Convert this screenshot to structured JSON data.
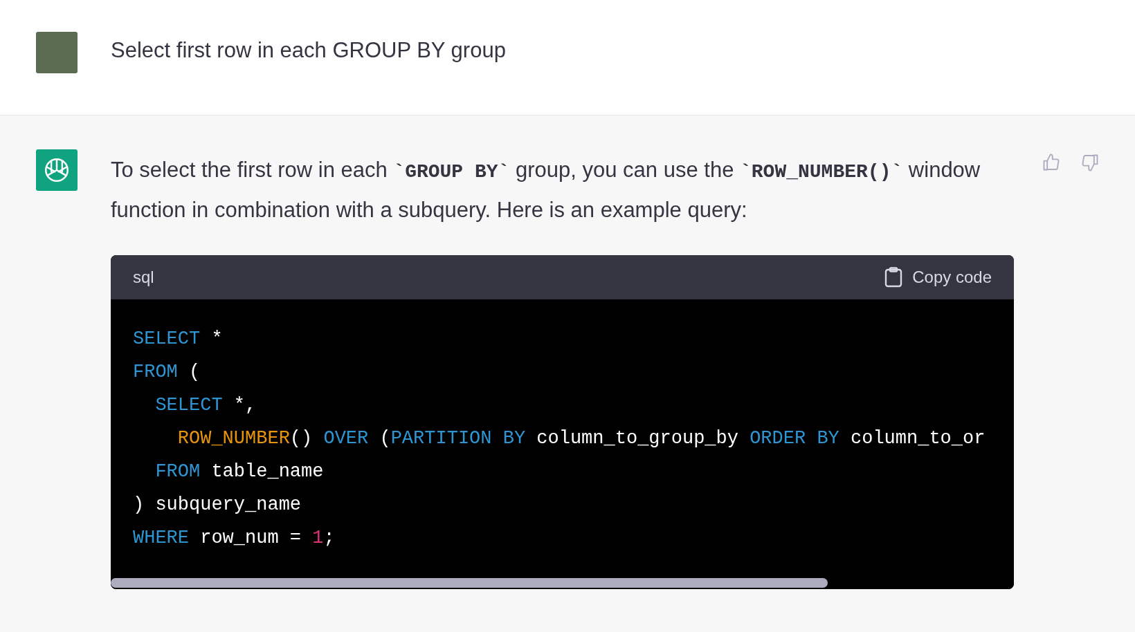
{
  "user_message": {
    "text": "Select first row in each GROUP BY group"
  },
  "assistant_message": {
    "paragraph": [
      {
        "kind": "text",
        "text": "To select the first row in each "
      },
      {
        "kind": "code",
        "text": "`GROUP BY`"
      },
      {
        "kind": "text",
        "text": " group, you can use the "
      },
      {
        "kind": "code",
        "text": "`ROW_NUMBER()`"
      },
      {
        "kind": "text",
        "text": " window function in combination with a subquery. Here is an example query:"
      }
    ],
    "code_block": {
      "language": "sql",
      "copy_label": "Copy code",
      "lines": [
        [
          {
            "kind": "keyword",
            "text": "SELECT"
          },
          {
            "kind": "plain",
            "text": " *"
          }
        ],
        [
          {
            "kind": "keyword",
            "text": "FROM"
          },
          {
            "kind": "plain",
            "text": " ("
          }
        ],
        [
          {
            "kind": "keyword",
            "text": "  SELECT"
          },
          {
            "kind": "plain",
            "text": " *,"
          }
        ],
        [
          {
            "kind": "function",
            "text": "    ROW_NUMBER"
          },
          {
            "kind": "plain",
            "text": "() "
          },
          {
            "kind": "keyword",
            "text": "OVER"
          },
          {
            "kind": "plain",
            "text": " ("
          },
          {
            "kind": "keyword",
            "text": "PARTITION BY"
          },
          {
            "kind": "plain",
            "text": " column_to_group_by "
          },
          {
            "kind": "keyword",
            "text": "ORDER BY"
          },
          {
            "kind": "plain",
            "text": " column_to_or"
          }
        ],
        [
          {
            "kind": "keyword",
            "text": "  FROM"
          },
          {
            "kind": "plain",
            "text": " table_name"
          }
        ],
        [
          {
            "kind": "plain",
            "text": ") subquery_name"
          }
        ],
        [
          {
            "kind": "keyword",
            "text": "WHERE"
          },
          {
            "kind": "plain",
            "text": " row_num = "
          },
          {
            "kind": "number",
            "text": "1"
          },
          {
            "kind": "plain",
            "text": ";"
          }
        ]
      ]
    }
  }
}
